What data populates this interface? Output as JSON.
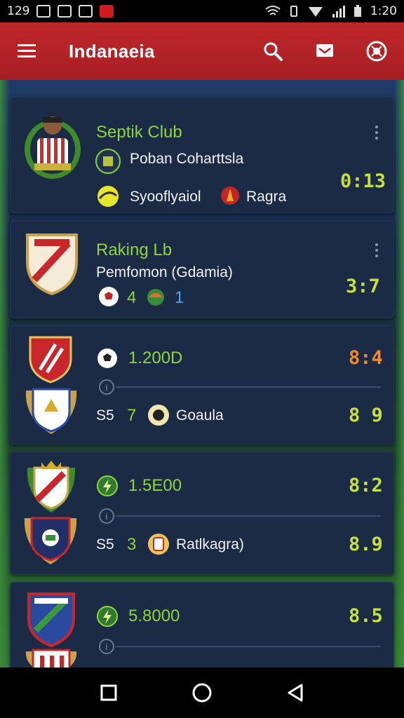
{
  "status_bar": {
    "left_time": "129",
    "right_time": "1:20"
  },
  "app_bar": {
    "title": "Indanaeia"
  },
  "cards": [
    {
      "club": "Septik Club",
      "subtitle": "Poban Coharttsla",
      "item_one": "Syooflyaiol",
      "item_two": "Ragra",
      "score": "0:13"
    },
    {
      "club": "Raking Lb",
      "subtitle": "Pemfomon (Gdamia)",
      "count_one": "4",
      "count_two": "1",
      "score": "3:7"
    },
    {
      "value": "1.200D",
      "score_top": "8:4",
      "left_code": "S5",
      "left_num": "7",
      "team": "Goaula",
      "score_bottom": "8 9"
    },
    {
      "value": "1.5E00",
      "score_top": "8:2",
      "left_code": "S5",
      "left_num": "3",
      "team": "Ratlkagra)",
      "score_bottom": "8.9"
    },
    {
      "value": "5.8000",
      "score_top": "8.5"
    }
  ],
  "colors": {
    "appbar": "#b42226",
    "card": "#1b2a45",
    "accent_green": "#8fd63a",
    "accent_orange": "#f08a2c"
  }
}
